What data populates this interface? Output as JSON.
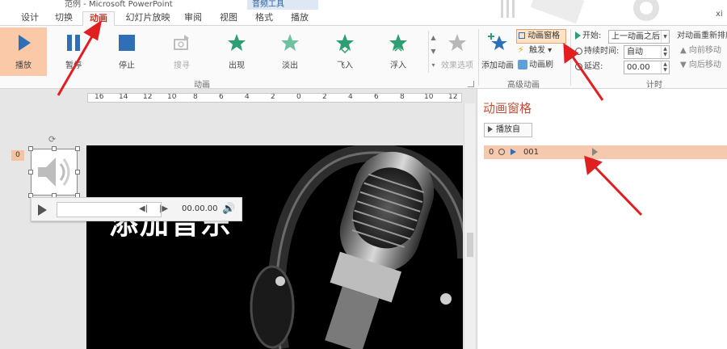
{
  "window": {
    "title": "范例 - Microsoft PowerPoint",
    "context_tab_group": "音频工具"
  },
  "tabs": [
    {
      "label": "设计"
    },
    {
      "label": "切换"
    },
    {
      "label": "动画",
      "active": true
    },
    {
      "label": "幻灯片放映"
    },
    {
      "label": "审阅"
    },
    {
      "label": "视图"
    },
    {
      "label": "格式"
    },
    {
      "label": "播放"
    }
  ],
  "user_partial": "xi",
  "ribbon": {
    "preview": {
      "label": "播放"
    },
    "animations": [
      {
        "label": "暂停",
        "icon": "pause-icon"
      },
      {
        "label": "停止",
        "icon": "stop-icon"
      },
      {
        "label": "搜寻",
        "icon": "seek-icon",
        "disabled": true
      },
      {
        "label": "出现",
        "icon": "star-icon"
      },
      {
        "label": "淡出",
        "icon": "star-icon"
      },
      {
        "label": "飞入",
        "icon": "star-icon"
      },
      {
        "label": "浮入",
        "icon": "star-icon"
      }
    ],
    "effect_options": {
      "label": "效果选项"
    },
    "animations_group_label": "动画",
    "add_animation": {
      "label": "添加动画"
    },
    "animation_pane_button": {
      "label": "动画窗格"
    },
    "trigger": {
      "label": "触发"
    },
    "animation_painter": {
      "label": "动画刷"
    },
    "advanced_group_label": "高级动画",
    "timing": {
      "start_label": "开始:",
      "start_value": "上一动画之后",
      "duration_label": "持续时间:",
      "duration_value": "自动",
      "delay_label": "延迟:",
      "delay_value": "00.00",
      "group_label": "计时"
    },
    "reorder": {
      "title": "对动画重新排序",
      "forward": "向前移动",
      "backward": "向后移动"
    }
  },
  "ruler": {
    "ticks": [
      "16",
      "14",
      "12",
      "10",
      "8",
      "6",
      "4",
      "2",
      "0",
      "2",
      "4",
      "6",
      "8",
      "10",
      "12"
    ]
  },
  "slide": {
    "number": "0",
    "title": "添加音乐"
  },
  "player": {
    "time": "00.00.00"
  },
  "animation_pane": {
    "title": "动画窗格",
    "play_from": "播放自",
    "items": [
      {
        "index": "0",
        "name": "001"
      }
    ]
  }
}
